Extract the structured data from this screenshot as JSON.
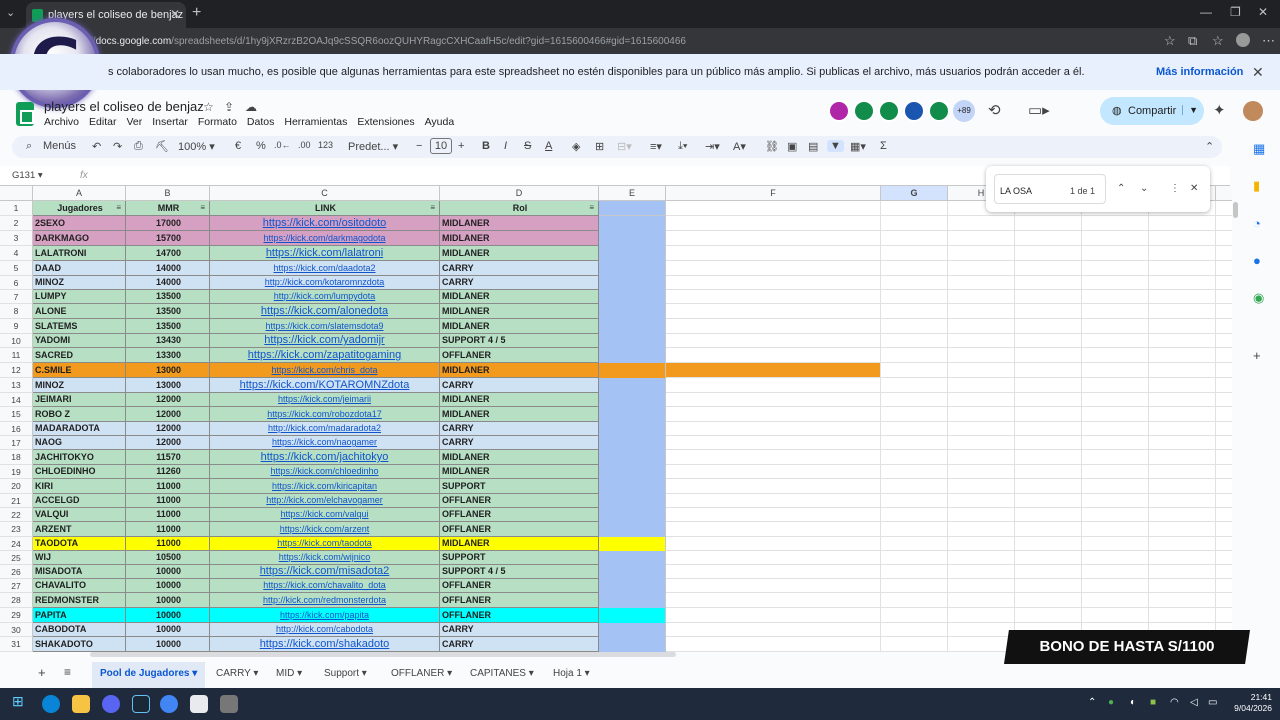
{
  "browser": {
    "tab_title": "players el coliseo de benjaz - Hoja",
    "url_host": "docs.google.com",
    "url_path": "/spreadsheets/d/1hy9jXRzrzB2OAJq9cSSQR6oozQUHYRagcCXHCaafH5c/edit?gid=1615600466#gid=1615600466"
  },
  "banner": {
    "text": "s colaboradores lo usan mucho, es posible que algunas herramientas para este spreadsheet no estén disponibles para un público más amplio. Si publicas el archivo, más usuarios podrán acceder a él.",
    "link": "Más información"
  },
  "logo": {
    "letter": "G"
  },
  "doc": {
    "title": "players el coliseo de benjaz",
    "menu": [
      "Archivo",
      "Editar",
      "Ver",
      "Insertar",
      "Formato",
      "Datos",
      "Herramientas",
      "Extensiones",
      "Ayuda"
    ],
    "collaborators_more": "+89",
    "share": "Compartir"
  },
  "toolbar": {
    "menus": "Menús",
    "zoom": "100%",
    "currency": "€",
    "percent": "%",
    "dec_less": ".0←",
    "dec_more": ".00",
    "num_format": "123",
    "font": "Predet...",
    "font_size": "10"
  },
  "formula": {
    "namebox": "G131",
    "fx": "fx"
  },
  "columns": [
    "A",
    "B",
    "C",
    "D",
    "E",
    "F",
    "G",
    "H",
    "I",
    "J",
    "K",
    "L"
  ],
  "headers": {
    "a": "Jugadores",
    "b": "MMR",
    "c": "LINK",
    "d": "Rol"
  },
  "colors": {
    "pink": "#d6a0c2",
    "green": "#b6dfc4",
    "blue": "#cfe2f3",
    "orange": "#f29a1e",
    "yellow": "#ffff00",
    "cyan": "#00ffff",
    "col_e": "#a4c2f4",
    "header": "#b6dfc4"
  },
  "rows": [
    {
      "n": "2",
      "name": "2SEXO",
      "mmr": "17000",
      "link": "https://kick.com/ositodoto",
      "rol": "MIDLANER",
      "color": "pink",
      "big": true
    },
    {
      "n": "3",
      "name": "DARKMAGO",
      "mmr": "15700",
      "link": "https://kick.com/darkmagodota",
      "rol": "MIDLANER",
      "color": "pink",
      "big": false
    },
    {
      "n": "4",
      "name": "LALATRONI",
      "mmr": "14700",
      "link": "https://kick.com/lalatroni",
      "rol": "MIDLANER",
      "color": "green",
      "big": true
    },
    {
      "n": "5",
      "name": "DAAD",
      "mmr": "14000",
      "link": "https://kick.com/daadota2",
      "rol": "CARRY",
      "color": "blue",
      "big": false
    },
    {
      "n": "6",
      "name": "MINOZ",
      "mmr": "14000",
      "link": "http://kick.com/kotaromnzdota",
      "rol": "CARRY",
      "color": "blue",
      "big": false
    },
    {
      "n": "7",
      "name": "LUMPY",
      "mmr": "13500",
      "link": "http://kick.com/lumpydota",
      "rol": "MIDLANER",
      "color": "green",
      "big": false
    },
    {
      "n": "8",
      "name": "ALONE",
      "mmr": "13500",
      "link": "https://kick.com/alonedota",
      "rol": "MIDLANER",
      "color": "green",
      "big": true
    },
    {
      "n": "9",
      "name": "SLATEMS",
      "mmr": "13500",
      "link": "https://kick.com/slatemsdota9",
      "rol": "MIDLANER",
      "color": "green",
      "big": false
    },
    {
      "n": "10",
      "name": "YADOMI",
      "mmr": "13430",
      "link": "https://kick.com/yadomijr",
      "rol": "SUPPORT 4 / 5",
      "color": "green",
      "big": true
    },
    {
      "n": "11",
      "name": "SACRED",
      "mmr": "13300",
      "link": "https://kick.com/zapatitogaming",
      "rol": "OFFLANER",
      "color": "green",
      "big": true
    },
    {
      "n": "12",
      "name": "C.SMILE",
      "mmr": "13000",
      "link": "https://kick.com/chris_dota",
      "rol": "MIDLANER",
      "color": "orange",
      "big": false
    },
    {
      "n": "13",
      "name": "MINOZ",
      "mmr": "13000",
      "link": "https://kick.com/KOTAROMNZdota",
      "rol": "CARRY",
      "color": "blue",
      "big": true
    },
    {
      "n": "14",
      "name": "JEIMARI",
      "mmr": "12000",
      "link": "https://kick.com/jeimarii",
      "rol": "MIDLANER",
      "color": "green",
      "big": false
    },
    {
      "n": "15",
      "name": "ROBO Z",
      "mmr": "12000",
      "link": "https://kick.com/robozdota17",
      "rol": "MIDLANER",
      "color": "green",
      "big": false
    },
    {
      "n": "16",
      "name": "MADARADOTA",
      "mmr": "12000",
      "link": "http://kick.com/madaradota2",
      "rol": "CARRY",
      "color": "blue",
      "big": false
    },
    {
      "n": "17",
      "name": "NAOG",
      "mmr": "12000",
      "link": "https://kick.com/naogamer",
      "rol": "CARRY",
      "color": "blue",
      "big": false
    },
    {
      "n": "18",
      "name": "JACHITOKYO",
      "mmr": "11570",
      "link": "https://kick.com/jachitokyo",
      "rol": "MIDLANER",
      "color": "green",
      "big": true
    },
    {
      "n": "19",
      "name": "CHLOEDINHO",
      "mmr": "11260",
      "link": "https://kick.com/chloedinho",
      "rol": "MIDLANER",
      "color": "green",
      "big": false
    },
    {
      "n": "20",
      "name": "KIRI",
      "mmr": "11000",
      "link": "https://kick.com/kiricapitan",
      "rol": "SUPPORT",
      "color": "green",
      "big": false
    },
    {
      "n": "21",
      "name": "ACCELGD",
      "mmr": "11000",
      "link": "http://kick.com/elchavogamer",
      "rol": "OFFLANER",
      "color": "green",
      "big": false
    },
    {
      "n": "22",
      "name": "VALQUI",
      "mmr": "11000",
      "link": "https://kick.com/valqui",
      "rol": "OFFLANER",
      "color": "green",
      "big": false
    },
    {
      "n": "23",
      "name": "ARZENT",
      "mmr": "11000",
      "link": "https://kick.com/arzent",
      "rol": "OFFLANER",
      "color": "green",
      "big": false
    },
    {
      "n": "24",
      "name": "TAODOTA",
      "mmr": "11000",
      "link": "https://kick.com/taodota",
      "rol": "MIDLANER",
      "color": "yellow",
      "big": false
    },
    {
      "n": "25",
      "name": "WIJ",
      "mmr": "10500",
      "link": "https://kick.com/wijnico",
      "rol": "SUPPORT",
      "color": "green",
      "big": false
    },
    {
      "n": "26",
      "name": "MISADOTA",
      "mmr": "10000",
      "link": "https://kick.com/misadota2",
      "rol": "SUPPORT 4 / 5",
      "color": "green",
      "big": true
    },
    {
      "n": "27",
      "name": "CHAVALITO",
      "mmr": "10000",
      "link": "https://kick.com/chavalito_dota",
      "rol": "OFFLANER",
      "color": "green",
      "big": false
    },
    {
      "n": "28",
      "name": "REDMONSTER",
      "mmr": "10000",
      "link": "http://kick.com/redmonsterdota",
      "rol": "OFFLANER",
      "color": "green",
      "big": false
    },
    {
      "n": "29",
      "name": "PAPITA",
      "mmr": "10000",
      "link": "https://kick.com/papita",
      "rol": "OFFLANER",
      "color": "cyan",
      "big": false
    },
    {
      "n": "30",
      "name": "CABODOTA",
      "mmr": "10000",
      "link": "http://kick.com/cabodota",
      "rol": "CARRY",
      "color": "blue",
      "big": false
    },
    {
      "n": "31",
      "name": "SHAKADOTO",
      "mmr": "10000",
      "link": "https://kick.com/shakadoto",
      "rol": "CARRY",
      "color": "blue",
      "big": true
    }
  ],
  "find": {
    "query": "LA OSA",
    "count": "1 de 1"
  },
  "sheet_tabs": [
    "Pool de Jugadores",
    "CARRY",
    "MID",
    "Support",
    "OFFLANER",
    "CAPITANES",
    "Hoja 1"
  ],
  "ad": {
    "text": "BONO DE HASTA S/1100"
  },
  "clock": {
    "time": "21:41",
    "date": "9/04/2026"
  }
}
